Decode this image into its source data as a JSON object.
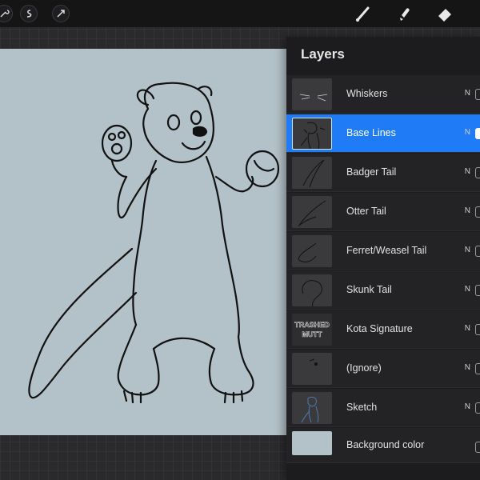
{
  "toolbar": {
    "left_tools": [
      "wrench-icon",
      "adjustments-icon",
      "selection-icon"
    ],
    "right_tools": [
      "brush-icon",
      "smudge-icon",
      "eraser-icon"
    ]
  },
  "layers_panel": {
    "title": "Layers",
    "layers": [
      {
        "name": "Whiskers",
        "blend": "N",
        "selected": false,
        "visible": true
      },
      {
        "name": "Base Lines",
        "blend": "N",
        "selected": true,
        "visible": true
      },
      {
        "name": "Badger Tail",
        "blend": "N",
        "selected": false,
        "visible": true
      },
      {
        "name": "Otter Tail",
        "blend": "N",
        "selected": false,
        "visible": true
      },
      {
        "name": "Ferret/Weasel Tail",
        "blend": "N",
        "selected": false,
        "visible": true
      },
      {
        "name": "Skunk Tail",
        "blend": "N",
        "selected": false,
        "visible": true
      },
      {
        "name": "Kota Signature",
        "blend": "N",
        "selected": false,
        "visible": true,
        "logo_text": "TRASHED MUTT"
      },
      {
        "name": "(Ignore)",
        "blend": "N",
        "selected": false,
        "visible": true
      },
      {
        "name": "Sketch",
        "blend": "N",
        "selected": false,
        "visible": true
      }
    ],
    "background": {
      "name": "Background color",
      "color": "#b3c2c8"
    }
  },
  "colors": {
    "accent": "#1f7cf6",
    "canvas": "#b3c2c8",
    "panel": "#1c1c1e"
  }
}
